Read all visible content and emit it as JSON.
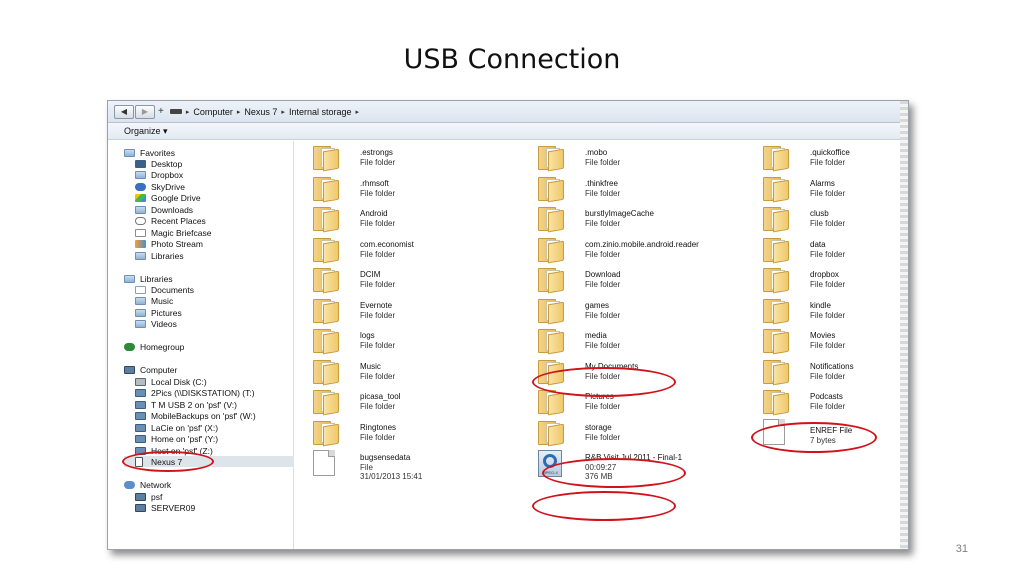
{
  "slide": {
    "title": "USB Connection",
    "number": "31"
  },
  "address_bar": {
    "back_glyph": "◀",
    "forward_glyph": "▶",
    "plus_glyph": "+",
    "separator_glyph": "▸",
    "crumbs": [
      "Computer",
      "Nexus 7",
      "Internal storage"
    ]
  },
  "toolbar": {
    "organize_label": "Organize ▾"
  },
  "nav": {
    "favorites": {
      "label": "Favorites",
      "items": [
        "Desktop",
        "Dropbox",
        "SkyDrive",
        "Google Drive",
        "Downloads",
        "Recent Places",
        "Magic Briefcase",
        "Photo Stream",
        "Libraries"
      ]
    },
    "libraries": {
      "label": "Libraries",
      "items": [
        "Documents",
        "Music",
        "Pictures",
        "Videos"
      ]
    },
    "homegroup": {
      "label": "Homegroup"
    },
    "computer": {
      "label": "Computer",
      "items": [
        "Local Disk (C:)",
        "2Pics (\\\\DISKSTATION) (T:)",
        "T M USB 2 on 'psf' (V:)",
        "MobileBackups on 'psf' (W:)",
        "LaCie on 'psf' (X:)",
        "Home on 'psf' (Y:)",
        "Host on 'psf' (Z:)",
        "Nexus 7"
      ]
    },
    "network": {
      "label": "Network",
      "items": [
        "psf",
        "SERVER09"
      ]
    }
  },
  "content": {
    "columns": [
      [
        {
          "name": ".estrongs",
          "detail": "File folder"
        },
        {
          "name": ".rhmsoft",
          "detail": "File folder"
        },
        {
          "name": "Android",
          "detail": "File folder"
        },
        {
          "name": "com.economist",
          "detail": "File folder"
        },
        {
          "name": "DCIM",
          "detail": "File folder"
        },
        {
          "name": "Evernote",
          "detail": "File folder"
        },
        {
          "name": "logs",
          "detail": "File folder"
        },
        {
          "name": "Music",
          "detail": "File folder"
        },
        {
          "name": "picasa_tool",
          "detail": "File folder"
        },
        {
          "name": "Ringtones",
          "detail": "File folder"
        }
      ],
      [
        {
          "name": ".mobo",
          "detail": "File folder"
        },
        {
          "name": ".thinkfree",
          "detail": "File folder"
        },
        {
          "name": "burstlyImageCache",
          "detail": "File folder"
        },
        {
          "name": "com.zinio.mobile.android.reader",
          "detail": "File folder"
        },
        {
          "name": "Download",
          "detail": "File folder"
        },
        {
          "name": "games",
          "detail": "File folder"
        },
        {
          "name": "media",
          "detail": "File folder"
        },
        {
          "name": "My Documents",
          "detail": "File folder"
        },
        {
          "name": "Pictures",
          "detail": "File folder"
        },
        {
          "name": "storage",
          "detail": "File folder"
        }
      ],
      [
        {
          "name": ".quickoffice",
          "detail": "File folder"
        },
        {
          "name": "Alarms",
          "detail": "File folder"
        },
        {
          "name": "clusb",
          "detail": "File folder"
        },
        {
          "name": "data",
          "detail": "File folder"
        },
        {
          "name": "dropbox",
          "detail": "File folder"
        },
        {
          "name": "kindle",
          "detail": "File folder"
        },
        {
          "name": "Movies",
          "detail": "File folder"
        },
        {
          "name": "Notifications",
          "detail": "File folder"
        },
        {
          "name": "Podcasts",
          "detail": "File folder"
        }
      ]
    ],
    "files": {
      "bugsensedata": {
        "name": "bugsensedata",
        "type": "File",
        "date": "31/01/2013 15:41"
      },
      "video": {
        "name": "R&B Visit Jul 2011 - Final-1",
        "duration": "00:09:27",
        "size": "376 MB",
        "icon_label": "MPEG-4"
      },
      "enref": {
        "name": "ENREF File",
        "size": "7 bytes"
      }
    }
  }
}
